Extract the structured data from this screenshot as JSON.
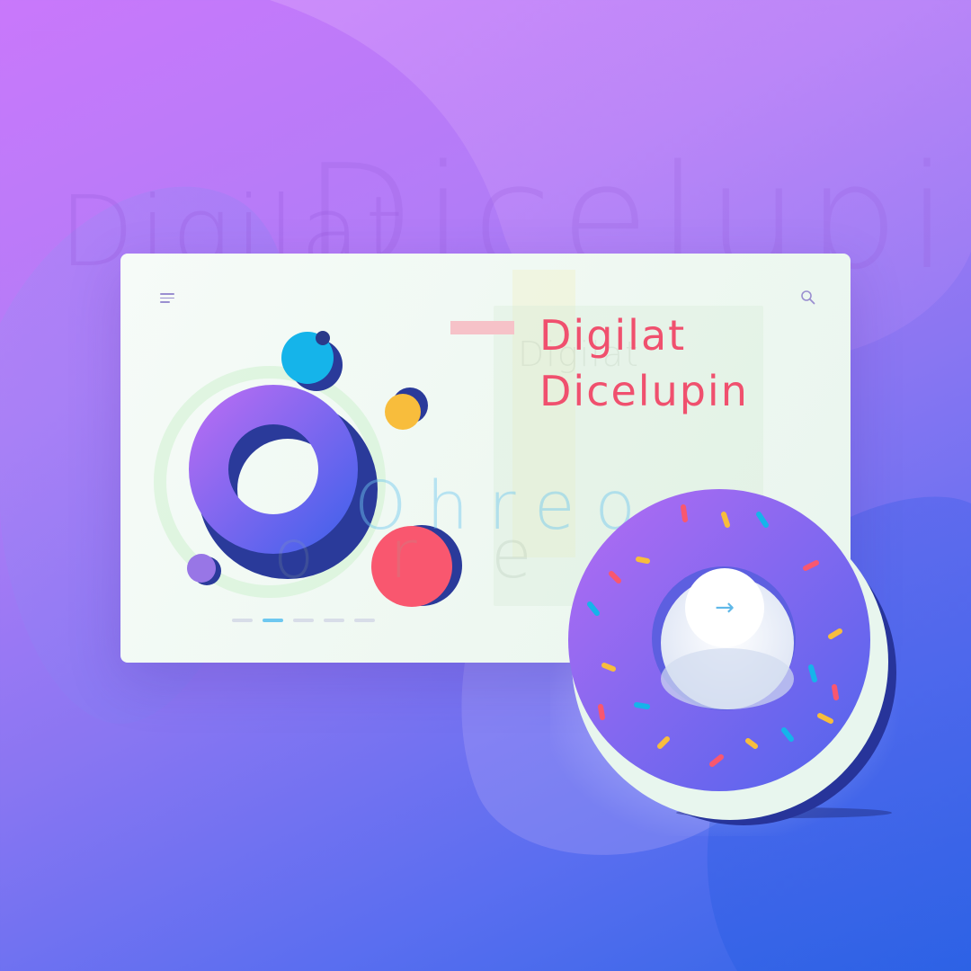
{
  "background": {
    "word_small": "Digilat",
    "word_large": "Dicelupin",
    "colors": {
      "top": "#c978fb",
      "bottom": "#2f66e6"
    }
  },
  "card": {
    "title_line1": "Digilat",
    "title_line2": "Dicelupin",
    "ghost_title": "Digilat",
    "ghost_word": "Ohreo",
    "ghost_word2": "ore",
    "accent_color": "#f0506e",
    "pager": {
      "count": 5,
      "active_index": 1
    }
  },
  "icons": {
    "menu": "hamburger-menu-icon",
    "search": "search-icon",
    "arrow": "arrow-right-icon"
  },
  "donut_button": {
    "label": "→"
  }
}
